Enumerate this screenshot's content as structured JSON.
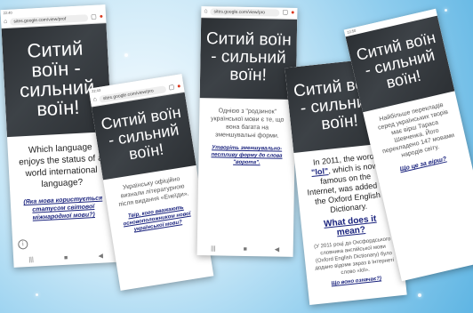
{
  "background_color": "#8fcdee",
  "phones": [
    {
      "status_time": "22:40",
      "url": "sites.google.com/view/prof",
      "title": "Ситий воїн - сильний воїн!",
      "question_en": "Which language enjoys the status of a world international language?",
      "link": "(Яка мова користується статусом світової міжнародної мови?)"
    },
    {
      "status_time": "22:43",
      "url": "sites.google.com/view/pro",
      "title": "Ситий воїн - сильний воїн!",
      "text": "Українську офіційно визнали літературною після видання «Енеїди».",
      "link": "Твір, кого вважають основоположником нової української мови?"
    },
    {
      "url": "sites.google.com/view/pro",
      "title": "Ситий воїн - сильний воїн!",
      "text": "Однією з \"родзинок\" української мови є те, що вона багата на зменшувальні форми.",
      "link": "Утворіть зменшувально-пестливу форму до слова \"ворота\"."
    },
    {
      "title": "Ситий воїн - сильний воїн!",
      "text_pre": "In 2011, the word ",
      "word": "\"lol\"",
      "text_post": ", which is now famous on the Internet, was added to the Oxford English Dictionary.",
      "heading": "What does it mean?",
      "ua": "(У 2011 році до Оксфордського словника англійської мови (Oxford English Dictionary) було додано відоме зараз в Інтернеті слово «lol».",
      "link": "Що воно означає?)"
    },
    {
      "status_time": "22:50",
      "title": "Ситий воїн - сильний воїн!",
      "text": "Найбільше перекладів серед українських творів має вірш Тараса Шевченка. Його перекладено 147 мовами народів світу.",
      "link": "Що це за вірш?"
    }
  ]
}
